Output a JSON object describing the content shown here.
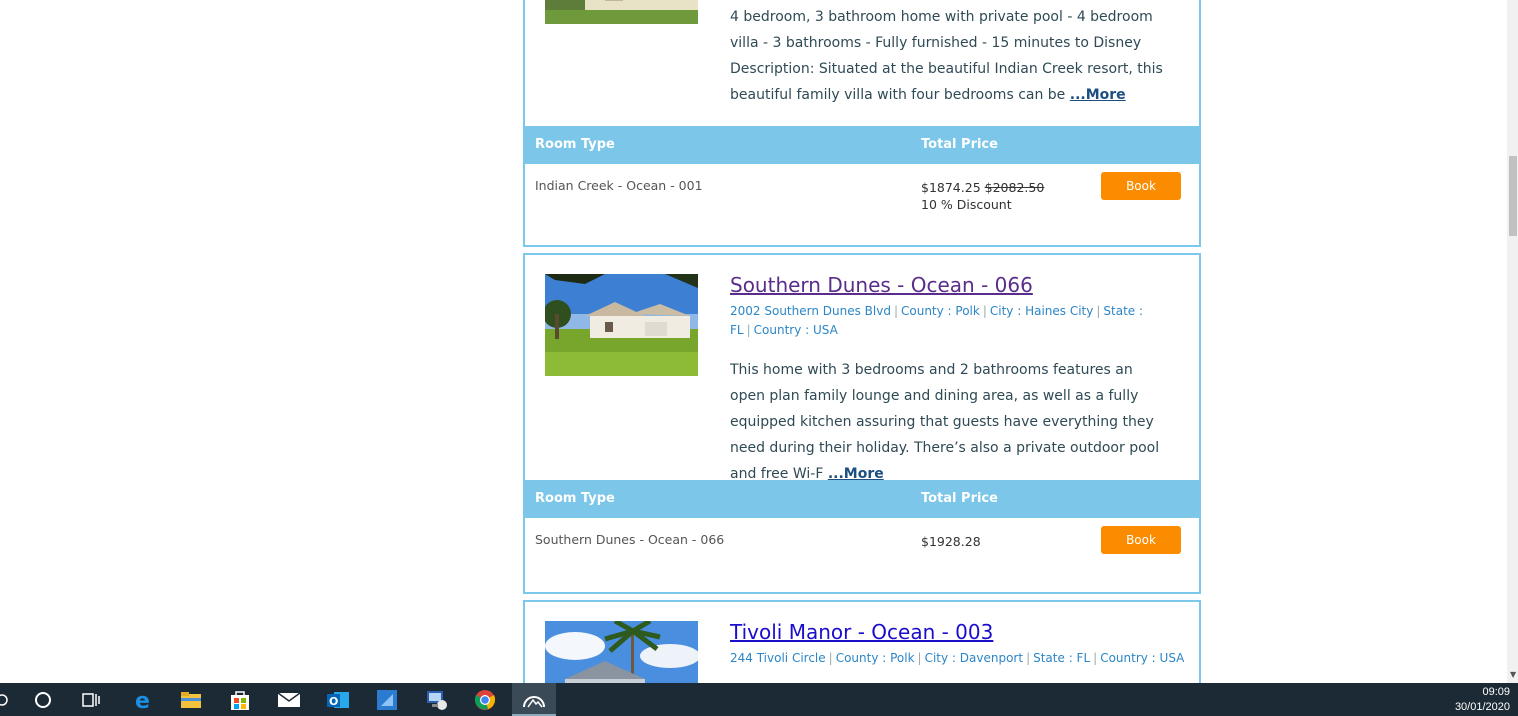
{
  "listings": [
    {
      "title": "",
      "description": "4 bedroom, 3 bathroom home with private pool - 4 bedroom villa - 3 bathrooms - Fully furnished - 15 minutes to Disney Description: Situated at the beautiful Indian Creek resort, this beautiful family villa with four bedrooms can be",
      "more_label": "...More",
      "table": {
        "col_room": "Room Type",
        "col_price": "Total Price",
        "room": "Indian Creek - Ocean - 001",
        "price": "$1874.25",
        "old_price": "$2082.50",
        "discount": "10 % Discount",
        "book_label": "Book"
      }
    },
    {
      "title": "Southern Dunes - Ocean - 066",
      "address": "2002 Southern Dunes Blvd",
      "county": "County : Polk",
      "city": "City : Haines City",
      "state": "State : FL",
      "country": "Country : USA",
      "description": "This home with 3 bedrooms and 2 bathrooms features an open plan family lounge and dining area, as well as a fully equipped kitchen assuring that guests have everything they need during their holiday. There’s also a private outdoor pool and free Wi-F",
      "more_label": "...More",
      "table": {
        "col_room": "Room Type",
        "col_price": "Total Price",
        "room": "Southern Dunes - Ocean - 066",
        "price": "$1928.28",
        "book_label": "Book"
      }
    },
    {
      "title": "Tivoli Manor - Ocean - 003",
      "address": "244 Tivoli Circle",
      "county": "County : Polk",
      "city": "City : Davenport",
      "state": "State : FL",
      "country": "Country : USA"
    }
  ],
  "taskbar": {
    "icons": [
      "cortana-icon",
      "task-view-icon",
      "edge-icon",
      "file-explorer-icon",
      "store-icon",
      "mail-icon",
      "outlook-icon",
      "remote-desktop-icon",
      "network-tool-icon",
      "chrome-icon",
      "photos-icon"
    ],
    "time": "09:09",
    "date": "30/01/2020"
  }
}
